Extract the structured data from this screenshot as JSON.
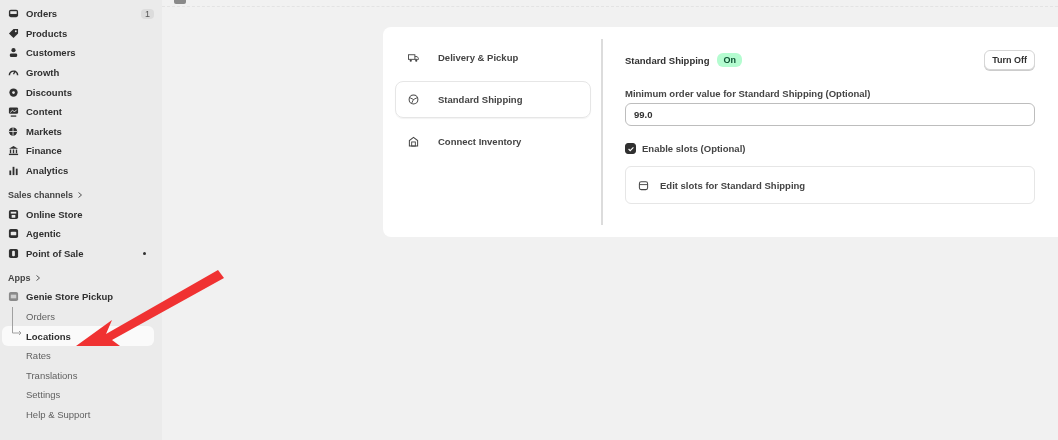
{
  "sidebar": {
    "items": [
      {
        "label": "Orders",
        "badge": "1"
      },
      {
        "label": "Products"
      },
      {
        "label": "Customers"
      },
      {
        "label": "Growth"
      },
      {
        "label": "Discounts"
      },
      {
        "label": "Content"
      },
      {
        "label": "Markets"
      },
      {
        "label": "Finance"
      },
      {
        "label": "Analytics"
      }
    ],
    "sales_channels": {
      "title": "Sales channels",
      "items": [
        {
          "label": "Online Store",
          "dot": false
        },
        {
          "label": "Agentic",
          "dot": false
        },
        {
          "label": "Point of Sale",
          "dot": true
        }
      ]
    },
    "apps": {
      "title": "Apps",
      "app": "Genie Store Pickup",
      "children": [
        {
          "label": "Orders",
          "selected": false
        },
        {
          "label": "Locations",
          "selected": true
        },
        {
          "label": "Rates",
          "selected": false
        },
        {
          "label": "Translations",
          "selected": false
        },
        {
          "label": "Settings",
          "selected": false
        },
        {
          "label": "Help & Support",
          "selected": false
        }
      ]
    }
  },
  "settings_nav": [
    {
      "label": "Delivery & Pickup",
      "selected": false
    },
    {
      "label": "Standard Shipping",
      "selected": true
    },
    {
      "label": "Connect Inventory",
      "selected": false
    }
  ],
  "panel": {
    "title": "Standard Shipping",
    "status": {
      "label": "On",
      "on": true
    },
    "toggle_button": "Turn Off",
    "min_order": {
      "label": "Minimum order value for Standard Shipping (Optional)",
      "value": "99.0"
    },
    "enable_slots": {
      "label": "Enable slots (Optional)",
      "checked": true
    },
    "edit_slots": "Edit slots for Standard Shipping"
  }
}
